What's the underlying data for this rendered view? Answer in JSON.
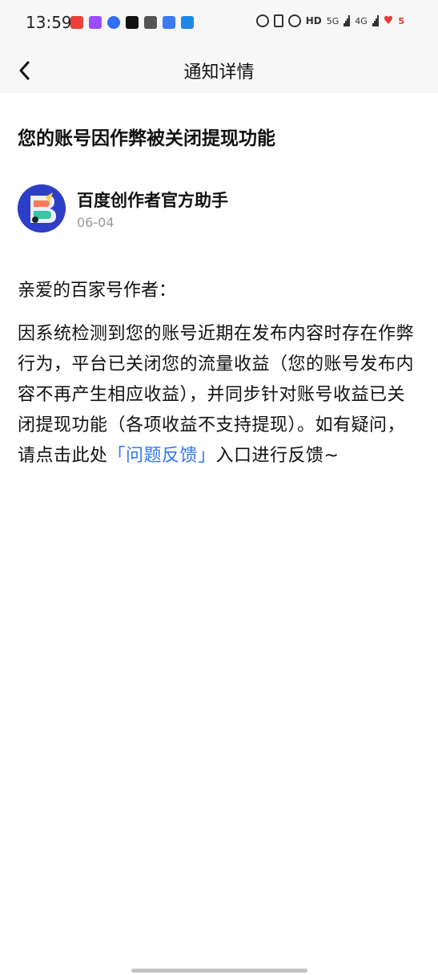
{
  "status_bar": {
    "time": "13:59",
    "network_1": "5G",
    "network_2": "4G",
    "hd_label": "HD",
    "battery_label": "5"
  },
  "nav": {
    "title": "通知详情",
    "back_icon": "chevron-left-icon"
  },
  "notice": {
    "title": "您的账号因作弊被关闭提现功能",
    "sender": {
      "name": "百度创作者官方助手",
      "date": "06-04"
    },
    "greeting": "亲爱的百家号作者：",
    "body_prefix": "因系统检测到您的账号近期在发布内容时存在作弊行为，平台已关闭您的流量收益（您的账号发布内容不再产生相应收益），并同步针对账号收益已关闭提现功能（各项收益不支持提现）。如有疑问，请点击此处",
    "feedback_link": "「问题反馈」",
    "body_suffix": "入口进行反馈~"
  },
  "colors": {
    "link": "#3477f5",
    "avatar_bg": "#2d3ec7",
    "date_text": "#999999"
  }
}
